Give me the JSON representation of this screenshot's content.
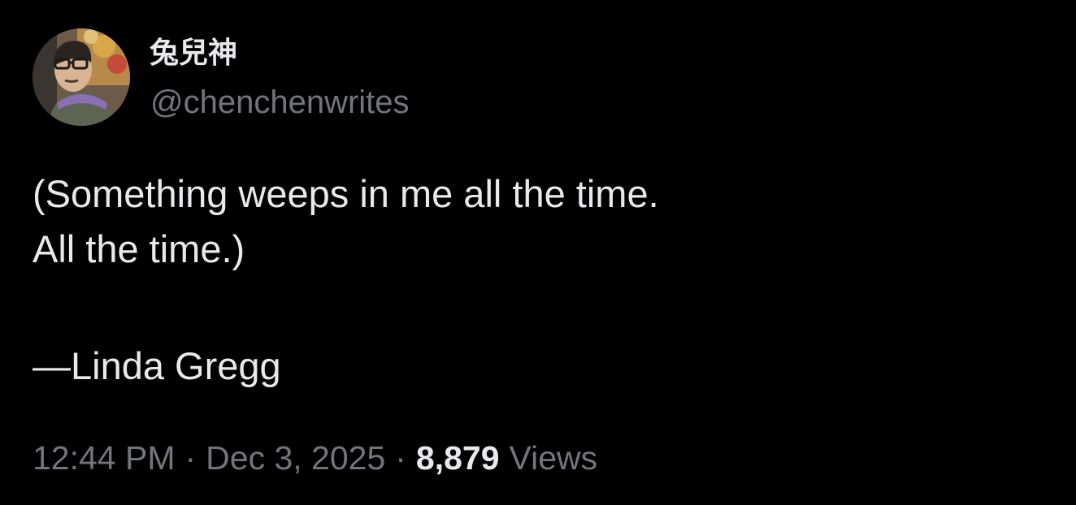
{
  "author": {
    "display_name": "兔兒神",
    "handle": "@chenchenwrites",
    "avatar_icon": "profile-photo"
  },
  "tweet": {
    "lines": [
      "(Something weeps in me all the time.",
      "All the time.)",
      "",
      "—Linda Gregg"
    ]
  },
  "meta": {
    "time": "12:44 PM",
    "separator": "·",
    "date": "Dec 3, 2025",
    "views_count": "8,879",
    "views_label": "Views"
  },
  "colors": {
    "background": "#000000",
    "primary_text": "#e7e9ea",
    "secondary_text": "#71767b"
  }
}
